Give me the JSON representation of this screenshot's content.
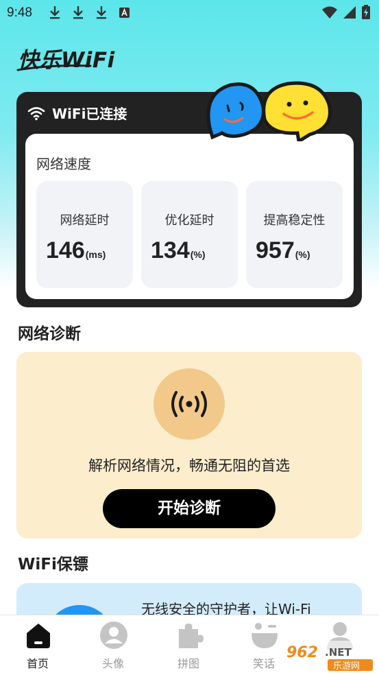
{
  "status_bar": {
    "time": "9:48"
  },
  "app": {
    "logo_text": "快乐WiFi"
  },
  "wifi_card": {
    "title": "WiFi已连接",
    "speed_title": "网络速度",
    "stats": [
      {
        "label": "网络延时",
        "value": "146",
        "unit": "(ms)"
      },
      {
        "label": "优化延时",
        "value": "134",
        "unit": "(%)"
      },
      {
        "label": "提高稳定性",
        "value": "957",
        "unit": "(%)"
      }
    ]
  },
  "diagnose": {
    "section_title": "网络诊断",
    "description": "解析网络情况，畅通无阻的首选",
    "button_label": "开始诊断"
  },
  "guard": {
    "section_title": "WiFi保镖",
    "text": "无线安全的守护者，让Wi-Fi"
  },
  "bottom_nav": {
    "items": [
      {
        "label": "首页",
        "icon": "home-icon",
        "active": true
      },
      {
        "label": "头像",
        "icon": "avatar-icon",
        "active": false
      },
      {
        "label": "拼图",
        "icon": "puzzle-icon",
        "active": false
      },
      {
        "label": "笑话",
        "icon": "laugh-icon",
        "active": false
      },
      {
        "label": "",
        "icon": "profile-icon",
        "active": false
      }
    ]
  },
  "watermark": {
    "top": "962.NET",
    "bottom": "乐游网"
  },
  "colors": {
    "accent": "#000000",
    "diag_bg": "#fcedcc",
    "guard_bg": "#d2ecfb",
    "mascot_blue": "#2196f3",
    "mascot_yellow": "#ffe033"
  }
}
